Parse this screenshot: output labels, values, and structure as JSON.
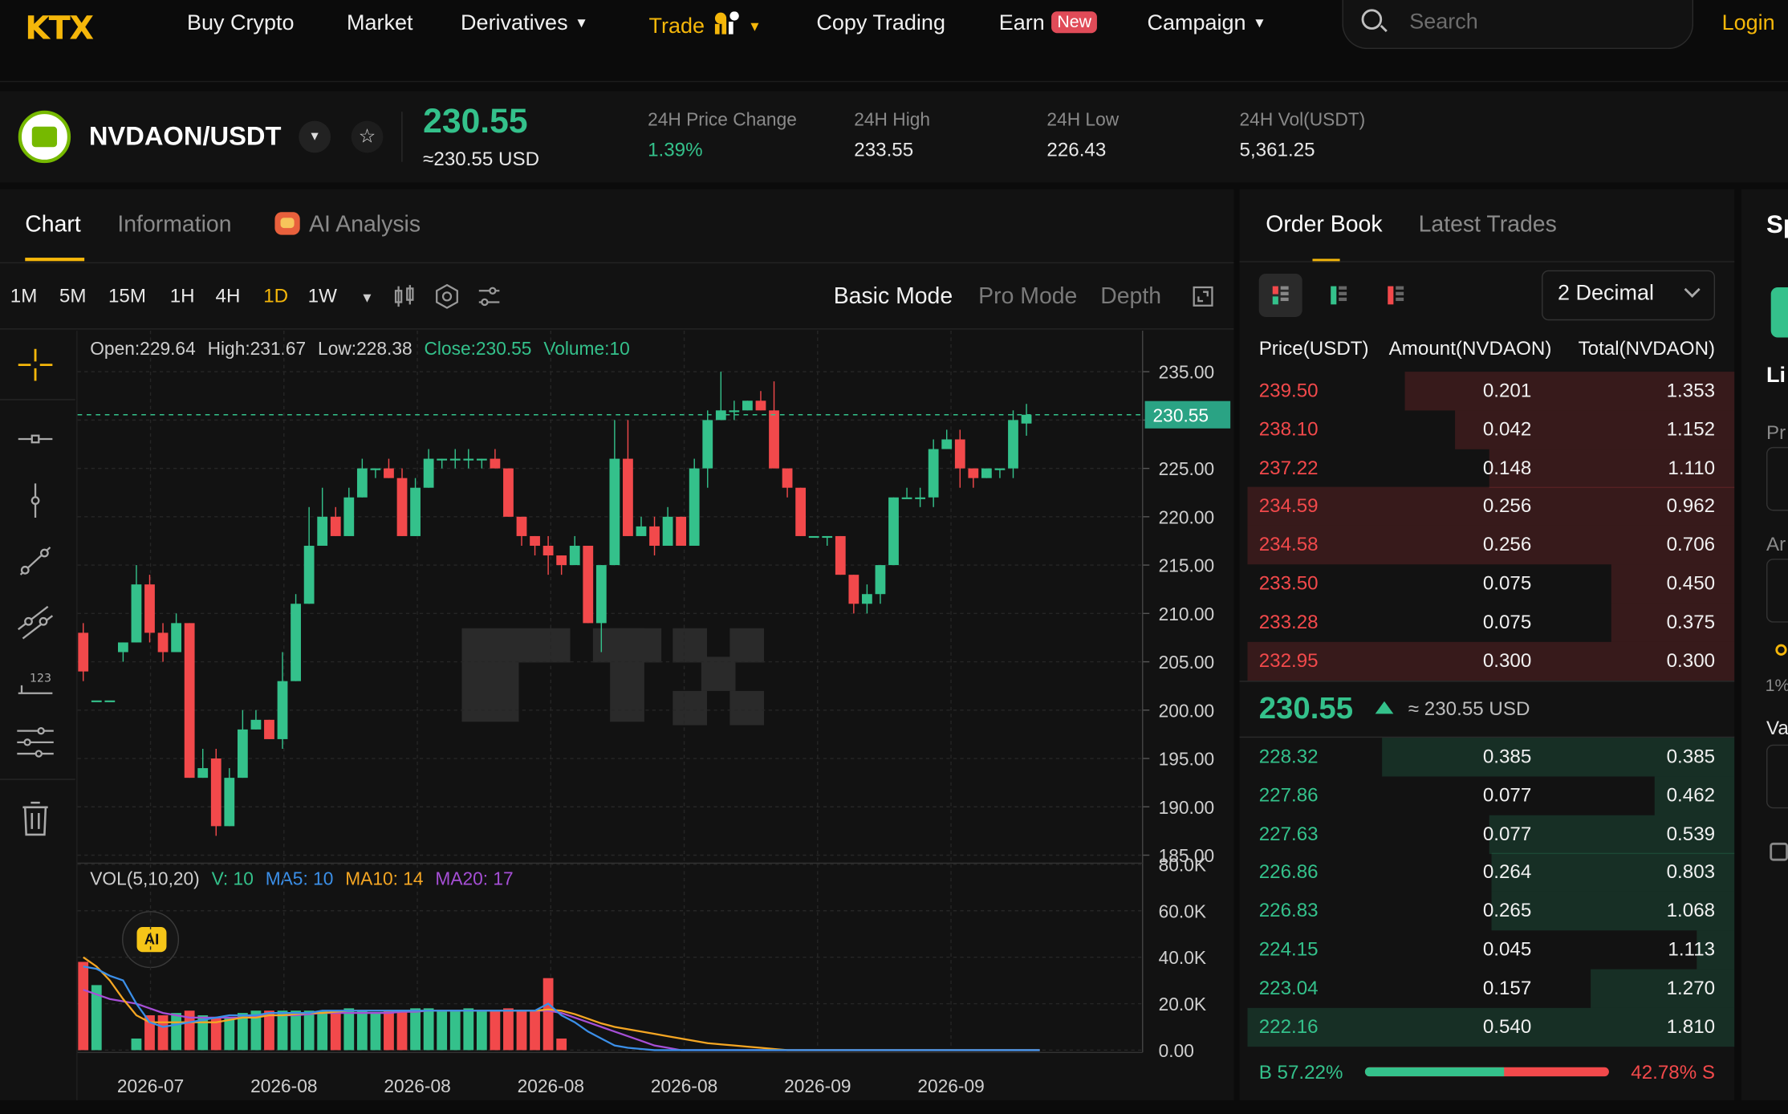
{
  "nav": {
    "logo": "KTX",
    "items": [
      {
        "label": "Buy Crypto"
      },
      {
        "label": "Market"
      },
      {
        "label": "Derivatives"
      },
      {
        "label": "Trade"
      },
      {
        "label": "Copy Trading"
      },
      {
        "label": "Earn"
      },
      {
        "label": "Campaign"
      }
    ],
    "earn_badge": "New",
    "search_placeholder": "Search",
    "login_label": "Login"
  },
  "ticker": {
    "pair": "NVDAON/USDT",
    "last_price": "230.55",
    "last_price_usd": "≈230.55 USD",
    "stats": [
      {
        "label": "24H Price Change",
        "value": "1.39%"
      },
      {
        "label": "24H High",
        "value": "233.55"
      },
      {
        "label": "24H Low",
        "value": "226.43"
      },
      {
        "label": "24H Vol(USDT)",
        "value": "5,361.25"
      }
    ]
  },
  "colors": {
    "up": "#34c18b",
    "down": "#f2494b",
    "accent": "#f5b70a",
    "ma5": "#3b8fe8",
    "ma10": "#f5a623",
    "ma20": "#a64fd6"
  },
  "chart_tabs": [
    {
      "label": "Chart"
    },
    {
      "label": "Information"
    },
    {
      "label": "AI Analysis"
    }
  ],
  "intervals": [
    "1M",
    "5M",
    "15M",
    "1H",
    "4H",
    "1D",
    "1W"
  ],
  "active_interval": "1D",
  "modes": [
    "Basic Mode",
    "Pro Mode",
    "Depth"
  ],
  "ohlc_legend": {
    "open": "Open:229.64",
    "high": "High:231.67",
    "low": "Low:228.38",
    "close": "Close:230.55",
    "volume": "Volume:10"
  },
  "vol_legend": {
    "label": "VOL(5,10,20)",
    "v": "V: 10",
    "ma5": "MA5: 10",
    "ma10": "MA10: 14",
    "ma20": "MA20: 17"
  },
  "price_tag": "230.55",
  "ai_badge": "AI",
  "chart_data": {
    "type": "candlestick",
    "price_axis": {
      "min": 185,
      "max": 235,
      "ticks": [
        "235.00",
        "230.00",
        "225.00",
        "220.00",
        "215.00",
        "210.00",
        "205.00",
        "200.00",
        "195.00",
        "190.00",
        "185.00"
      ]
    },
    "volume_axis": {
      "min": 0,
      "max": 80000,
      "ticks": [
        "80.0K",
        "60.0K",
        "40.0K",
        "20.0K",
        "0.00"
      ]
    },
    "x_ticks": [
      "2026-07",
      "2026-08",
      "2026-08",
      "2026-08",
      "2026-08",
      "2026-09",
      "2026-09"
    ],
    "candles": [
      [
        208,
        204,
        209,
        203
      ],
      [
        201,
        201,
        201,
        201
      ],
      [
        201,
        201,
        201,
        201
      ],
      [
        206,
        207,
        207,
        205
      ],
      [
        207,
        213,
        215,
        207
      ],
      [
        213,
        208,
        214,
        207
      ],
      [
        208,
        206,
        209,
        205
      ],
      [
        206,
        209,
        210,
        206
      ],
      [
        209,
        193,
        209,
        193
      ],
      [
        193,
        194,
        196,
        193
      ],
      [
        195,
        188,
        196,
        187
      ],
      [
        188,
        193,
        194,
        188
      ],
      [
        193,
        198,
        200,
        193
      ],
      [
        198,
        199,
        200,
        198
      ],
      [
        199,
        197,
        199,
        197
      ],
      [
        197,
        203,
        206,
        196
      ],
      [
        203,
        211,
        212,
        203
      ],
      [
        211,
        217,
        221,
        211
      ],
      [
        217,
        220,
        223,
        217
      ],
      [
        220,
        218,
        221,
        218
      ],
      [
        218,
        222,
        223,
        218
      ],
      [
        222,
        225,
        226,
        222
      ],
      [
        225,
        225,
        225,
        224
      ],
      [
        225,
        224,
        226,
        224
      ],
      [
        224,
        218,
        225,
        218
      ],
      [
        218,
        223,
        224,
        218
      ],
      [
        223,
        226,
        227,
        223
      ],
      [
        226,
        226,
        226,
        225
      ],
      [
        226,
        226,
        227,
        225
      ],
      [
        226,
        226,
        227,
        225
      ],
      [
        226,
        226,
        226,
        225
      ],
      [
        226,
        225,
        227,
        225
      ],
      [
        225,
        220,
        225,
        220
      ],
      [
        220,
        218,
        220,
        217
      ],
      [
        218,
        217,
        218,
        216
      ],
      [
        217,
        216,
        218,
        214
      ],
      [
        216,
        215,
        216,
        214
      ],
      [
        215,
        217,
        218,
        215
      ],
      [
        217,
        209,
        217,
        209
      ],
      [
        209,
        215,
        215,
        206
      ],
      [
        215,
        226,
        230,
        215
      ],
      [
        226,
        218,
        230,
        218
      ],
      [
        218,
        219,
        220,
        218
      ],
      [
        219,
        217,
        220,
        216
      ],
      [
        217,
        220,
        221,
        217
      ],
      [
        220,
        217,
        220,
        217
      ],
      [
        217,
        225,
        226,
        217
      ],
      [
        225,
        230,
        231,
        223
      ],
      [
        230,
        231,
        235,
        230
      ],
      [
        231,
        231,
        232,
        230
      ],
      [
        231,
        232,
        232,
        231
      ],
      [
        232,
        231,
        233,
        231
      ],
      [
        231,
        225,
        234,
        225
      ],
      [
        225,
        223,
        225,
        222
      ],
      [
        223,
        218,
        223,
        218
      ],
      [
        218,
        218,
        218,
        218
      ],
      [
        218,
        218,
        218,
        217
      ],
      [
        218,
        214,
        218,
        214
      ],
      [
        214,
        211,
        214,
        210
      ],
      [
        211,
        212,
        213,
        210
      ],
      [
        212,
        215,
        215,
        211
      ],
      [
        215,
        222,
        222,
        215
      ],
      [
        222,
        222,
        223,
        222
      ],
      [
        222,
        222,
        223,
        221
      ],
      [
        222,
        227,
        228,
        221
      ],
      [
        227,
        228,
        229,
        227
      ],
      [
        228,
        225,
        229,
        223
      ],
      [
        225,
        224,
        225,
        223
      ],
      [
        224,
        225,
        225,
        224
      ],
      [
        225,
        225,
        225,
        224
      ],
      [
        225,
        230,
        231,
        224
      ],
      [
        229.64,
        230.55,
        231.67,
        228.38
      ]
    ],
    "volumes": [
      38000,
      28000,
      0,
      0,
      5000,
      15000,
      15000,
      16000,
      17000,
      15000,
      14000,
      14000,
      16000,
      17000,
      17000,
      17000,
      17000,
      17000,
      17000,
      17000,
      18000,
      17000,
      16000,
      17000,
      17000,
      18000,
      18000,
      17000,
      17000,
      18000,
      17000,
      17000,
      18000,
      17000,
      17000,
      31000,
      5000,
      0,
      0,
      0,
      0,
      0,
      0,
      0,
      0,
      0,
      0,
      0,
      0,
      0,
      0,
      0,
      0,
      0,
      0,
      0,
      0,
      0,
      0,
      0,
      0,
      0,
      0,
      0,
      0,
      0,
      0,
      0,
      0,
      0,
      0,
      0,
      0
    ],
    "ma5": [
      36000,
      35000,
      32000,
      30000,
      20000,
      12000,
      10000,
      11000,
      12000,
      13000,
      14000,
      15000,
      15000,
      15000,
      16000,
      16000,
      16000,
      16000,
      17000,
      17000,
      17000,
      17000,
      17000,
      17000,
      17000,
      17000,
      17000,
      17000,
      17000,
      17000,
      17000,
      17000,
      17000,
      17000,
      17000,
      20000,
      15000,
      12000,
      8000,
      5000,
      2000,
      1000,
      500,
      0,
      0,
      0,
      0,
      0,
      0,
      0,
      0,
      0,
      0,
      0,
      0,
      0,
      0,
      0,
      0,
      0,
      0,
      0,
      0,
      0,
      0,
      0,
      0,
      0,
      0,
      0,
      0,
      0,
      0
    ],
    "ma10": [
      40000,
      36000,
      30000,
      22000,
      15000,
      12000,
      12000,
      12000,
      12000,
      12000,
      12000,
      13000,
      14000,
      14000,
      15000,
      15000,
      15500,
      16000,
      16000,
      16500,
      17000,
      17000,
      17000,
      17000,
      17000,
      17000,
      17000,
      17000,
      17000,
      17000,
      17000,
      17000,
      17000,
      17000,
      17000,
      17500,
      17000,
      15500,
      13500,
      11500,
      10000,
      9000,
      8000,
      7000,
      6000,
      5000,
      4000,
      3000,
      2500,
      2000,
      1500,
      1000,
      500,
      0,
      0,
      0,
      0,
      0,
      0,
      0,
      0,
      0,
      0,
      0,
      0,
      0,
      0,
      0,
      0,
      0,
      0,
      0,
      0
    ],
    "ma20": [
      26000,
      24000,
      22000,
      21000,
      20000,
      18000,
      16000,
      15000,
      14000,
      14000,
      14000,
      14000,
      14000,
      14500,
      15000,
      15000,
      15000,
      15500,
      16000,
      16000,
      16000,
      16000,
      16000,
      16000,
      16500,
      16500,
      17000,
      17000,
      17000,
      17000,
      17000,
      17000,
      17000,
      17000,
      17000,
      17000,
      16000,
      14000,
      12000,
      10000,
      8000,
      6000,
      4000,
      2000,
      1000,
      0,
      0,
      0,
      0,
      0,
      0,
      0,
      0,
      0,
      0,
      0,
      0,
      0,
      0,
      0,
      0,
      0,
      0,
      0,
      0,
      0,
      0,
      0,
      0,
      0,
      0,
      0,
      0
    ]
  },
  "orderbook": {
    "tabs": [
      {
        "label": "Order Book"
      },
      {
        "label": "Latest Trades"
      }
    ],
    "decimal": "2 Decimal",
    "headers": {
      "price": "Price(USDT)",
      "amount": "Amount(NVDAON)",
      "total": "Total(NVDAON)"
    },
    "asks": [
      {
        "price": "239.50",
        "amount": "0.201",
        "total": "1.353",
        "depth": 0.665
      },
      {
        "price": "238.10",
        "amount": "0.042",
        "total": "1.152",
        "depth": 0.565
      },
      {
        "price": "237.22",
        "amount": "0.148",
        "total": "1.110",
        "depth": 0.495
      },
      {
        "price": "234.59",
        "amount": "0.256",
        "total": "0.962",
        "depth": 0.985
      },
      {
        "price": "234.58",
        "amount": "0.256",
        "total": "0.706",
        "depth": 0.985
      },
      {
        "price": "233.50",
        "amount": "0.075",
        "total": "0.450",
        "depth": 0.248
      },
      {
        "price": "233.28",
        "amount": "0.075",
        "total": "0.375",
        "depth": 0.248
      },
      {
        "price": "232.95",
        "amount": "0.300",
        "total": "0.300",
        "depth": 0.985
      }
    ],
    "mid_price": "230.55",
    "mid_usd": "≈ 230.55 USD",
    "bids": [
      {
        "price": "228.32",
        "amount": "0.385",
        "total": "0.385",
        "depth": 0.713
      },
      {
        "price": "227.86",
        "amount": "0.077",
        "total": "0.462",
        "depth": 0.162
      },
      {
        "price": "227.63",
        "amount": "0.077",
        "total": "0.539",
        "depth": 0.495
      },
      {
        "price": "226.86",
        "amount": "0.264",
        "total": "0.803",
        "depth": 0.49
      },
      {
        "price": "226.83",
        "amount": "0.265",
        "total": "1.068",
        "depth": 0.49
      },
      {
        "price": "224.15",
        "amount": "0.045",
        "total": "1.113",
        "depth": 0.076
      },
      {
        "price": "223.04",
        "amount": "0.157",
        "total": "1.270",
        "depth": 0.291
      },
      {
        "price": "222.16",
        "amount": "0.540",
        "total": "1.810",
        "depth": 0.985
      }
    ],
    "buy_ratio_label": "B 57.22%",
    "sell_ratio_label": "42.78% S",
    "buy_ratio": 0.5722
  },
  "right_panel": {
    "title_fragment": "Sp",
    "labels": [
      "Li",
      "Pr",
      "Ar",
      "1%",
      "Va"
    ]
  }
}
